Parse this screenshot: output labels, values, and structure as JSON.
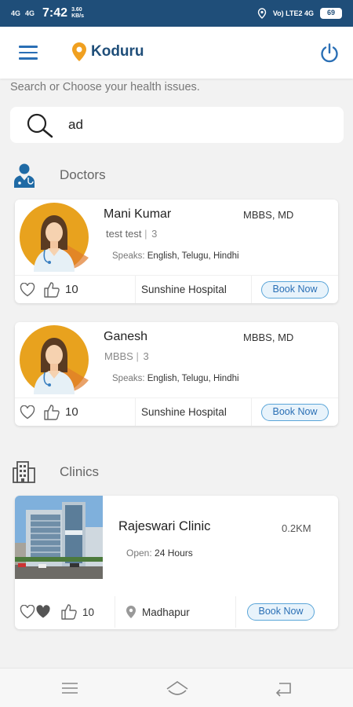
{
  "status_bar": {
    "time": "7:42",
    "net_speed": "3.60\nKB/s",
    "sig1": "4G",
    "sig2": "4G",
    "volte": "Vo) LTE2 4G",
    "battery": "69"
  },
  "header": {
    "location": "Koduru",
    "menu_icon": "hamburger-icon",
    "location_icon": "map-pin-icon",
    "power_icon": "power-icon"
  },
  "search": {
    "hint": "Search or Choose your health issues.",
    "value": "ad",
    "placeholder": ""
  },
  "doctors_section": {
    "title": "Doctors",
    "items": [
      {
        "name": "Mani Kumar",
        "qualification": "MBBS, MD",
        "specialty": "test test",
        "experience": "3",
        "speaks_label": "Speaks:",
        "languages": "English, Telugu, Hindhi",
        "likes": "10",
        "hospital": "Sunshine Hospital",
        "book_label": "Book Now"
      },
      {
        "name": "Ganesh",
        "qualification": "MBBS, MD",
        "specialty": "MBBS",
        "experience": "3",
        "speaks_label": "Speaks:",
        "languages": "English, Telugu, Hindhi",
        "likes": "10",
        "hospital": "Sunshine Hospital",
        "book_label": "Book Now"
      }
    ]
  },
  "clinics_section": {
    "title": "Clinics",
    "items": [
      {
        "name": "Rajeswari Clinic",
        "distance": "0.2KM",
        "open_label": "Open:",
        "open_hours": "24 Hours",
        "likes": "10",
        "area": "Madhapur",
        "book_label": "Book Now"
      }
    ]
  },
  "colors": {
    "status_bar": "#1f4e79",
    "accent": "#2a6fb5",
    "pin": "#f0a020",
    "book_border": "#5aa5d8"
  }
}
